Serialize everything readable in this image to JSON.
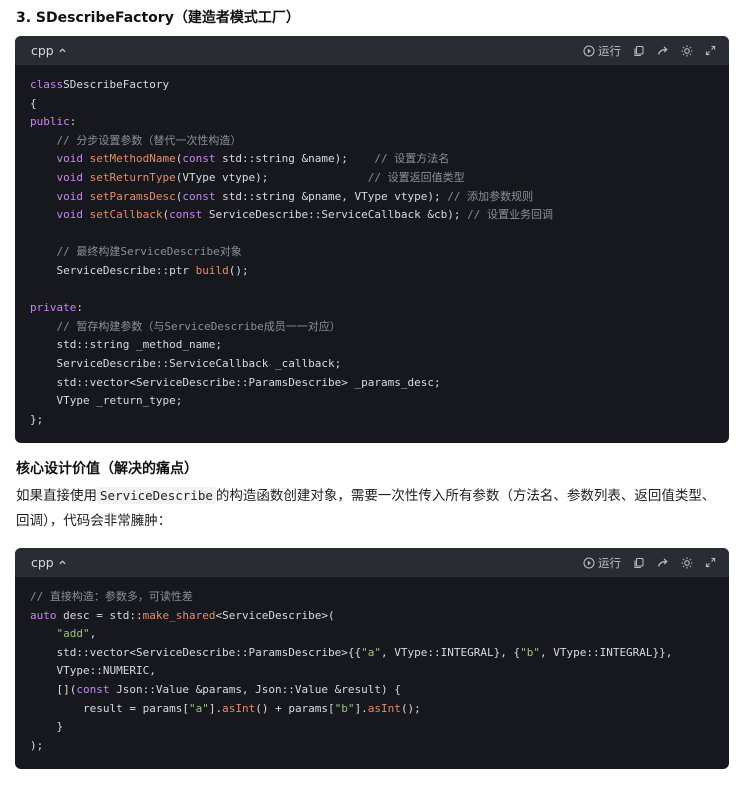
{
  "section": {
    "title": "3. SDescribeFactory（建造者模式工厂）",
    "subtitle": "核心设计价值（解决的痛点）",
    "paragraph_pre": "如果直接使用",
    "paragraph_code": "ServiceDescribe",
    "paragraph_post": "的构造函数创建对象，需要一次性传入所有参数（方法名、参数列表、返回值类型、回调），代码会非常臃肿："
  },
  "code_blocks": [
    {
      "lang": "cpp",
      "run_label": "运行",
      "lines": [
        [
          [
            "kw",
            "class"
          ],
          [
            "",
            "SDescribeFactory"
          ]
        ],
        [
          [
            "",
            "{"
          ]
        ],
        [
          [
            "kw",
            "public"
          ],
          [
            "",
            ":"
          ]
        ],
        [
          [
            "cm",
            "    // 分步设置参数（替代一次性构造）"
          ]
        ],
        [
          [
            "ty",
            "    void "
          ],
          [
            "fn",
            "setMethodName"
          ],
          [
            "",
            "("
          ],
          [
            "kw",
            "const"
          ],
          [
            "",
            " std::string &name);    "
          ],
          [
            "cm",
            "// 设置方法名"
          ]
        ],
        [
          [
            "ty",
            "    void "
          ],
          [
            "fn",
            "setReturnType"
          ],
          [
            "",
            "(VType vtype);               "
          ],
          [
            "cm",
            "// 设置返回值类型"
          ]
        ],
        [
          [
            "ty",
            "    void "
          ],
          [
            "fn",
            "setParamsDesc"
          ],
          [
            "",
            "("
          ],
          [
            "kw",
            "const"
          ],
          [
            "",
            " std::string &pname, VType vtype); "
          ],
          [
            "cm",
            "// 添加参数规则"
          ]
        ],
        [
          [
            "ty",
            "    void "
          ],
          [
            "fn",
            "setCallback"
          ],
          [
            "",
            "("
          ],
          [
            "kw",
            "const"
          ],
          [
            "",
            " ServiceDescribe::ServiceCallback &cb); "
          ],
          [
            "cm",
            "// 设置业务回调"
          ]
        ],
        [
          [
            "",
            ""
          ]
        ],
        [
          [
            "cm",
            "    // 最终构建ServiceDescribe对象"
          ]
        ],
        [
          [
            "",
            "    ServiceDescribe::ptr "
          ],
          [
            "fn",
            "build"
          ],
          [
            "",
            "();"
          ]
        ],
        [
          [
            "",
            ""
          ]
        ],
        [
          [
            "kw",
            "private"
          ],
          [
            "",
            ":"
          ]
        ],
        [
          [
            "cm",
            "    // 暂存构建参数（与ServiceDescribe成员一一对应）"
          ]
        ],
        [
          [
            "",
            "    std::string _method_name;"
          ]
        ],
        [
          [
            "",
            "    ServiceDescribe::ServiceCallback _callback;"
          ]
        ],
        [
          [
            "",
            "    std::vector<ServiceDescribe::ParamsDescribe> _params_desc;"
          ]
        ],
        [
          [
            "",
            "    VType _return_type;"
          ]
        ],
        [
          [
            "",
            "};"
          ]
        ]
      ]
    },
    {
      "lang": "cpp",
      "run_label": "运行",
      "lines": [
        [
          [
            "cm",
            "// 直接构造：参数多，可读性差"
          ]
        ],
        [
          [
            "kw",
            "auto"
          ],
          [
            "",
            " desc = std::"
          ],
          [
            "fn",
            "make_shared"
          ],
          [
            "",
            "<ServiceDescribe>("
          ]
        ],
        [
          [
            "st",
            "    \"add\""
          ],
          [
            "",
            ","
          ]
        ],
        [
          [
            "",
            "    std::vector<ServiceDescribe::ParamsDescribe>{{"
          ],
          [
            "st",
            "\"a\""
          ],
          [
            "",
            ", VType::INTEGRAL}, {"
          ],
          [
            "st",
            "\"b\""
          ],
          [
            "",
            ", VType::INTEGRAL}},"
          ]
        ],
        [
          [
            "",
            "    VType::NUMERIC,"
          ]
        ],
        [
          [
            "",
            "    []("
          ],
          [
            "kw",
            "const"
          ],
          [
            "",
            " Json::Value &params, Json::Value &result) {"
          ]
        ],
        [
          [
            "",
            "        result = params["
          ],
          [
            "st",
            "\"a\""
          ],
          [
            "",
            "]."
          ],
          [
            "fn",
            "asInt"
          ],
          [
            "",
            "() + params["
          ],
          [
            "st",
            "\"b\""
          ],
          [
            "",
            "]."
          ],
          [
            "fn",
            "asInt"
          ],
          [
            "",
            "();"
          ]
        ],
        [
          [
            "",
            "    }"
          ]
        ],
        [
          [
            "",
            ");"
          ]
        ]
      ]
    }
  ]
}
